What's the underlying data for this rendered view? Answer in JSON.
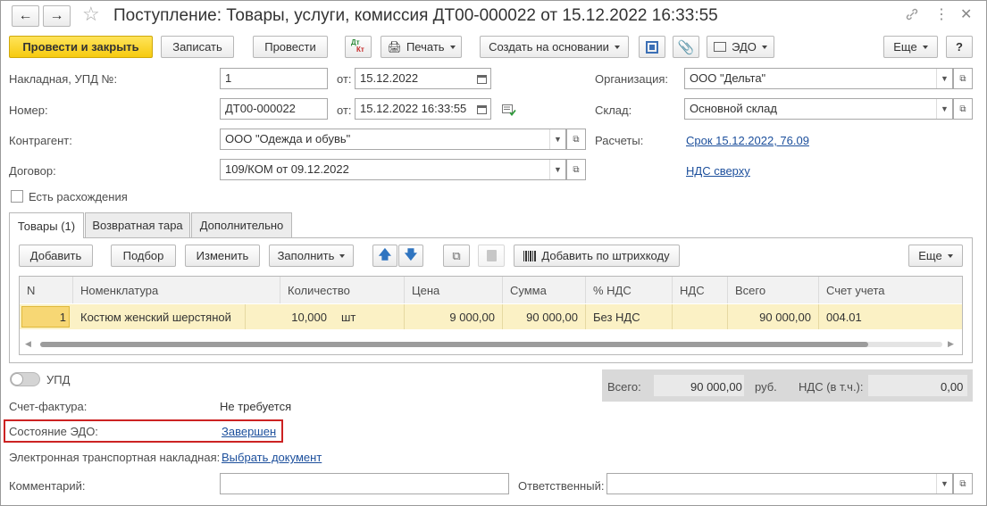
{
  "window": {
    "title": "Поступление: Товары, услуги, комиссия ДТ00-000022 от 15.12.2022 16:33:55"
  },
  "toolbar": {
    "post_close": "Провести и закрыть",
    "save": "Записать",
    "post": "Провести",
    "dtkt_top": "Дт",
    "dtkt_bottom": "Кт",
    "print": "Печать",
    "create_based": "Создать на основании",
    "edo": "ЭДО",
    "more": "Еще",
    "help": "?"
  },
  "form": {
    "invoice_label": "Накладная, УПД №:",
    "invoice_number": "1",
    "from_label": "от:",
    "invoice_date": "15.12.2022",
    "number_label": "Номер:",
    "number": "ДТ00-000022",
    "number_date": "15.12.2022 16:33:55",
    "counterparty_label": "Контрагент:",
    "counterparty": "ООО \"Одежда и обувь\"",
    "contract_label": "Договор:",
    "contract": "109/КОМ от 09.12.2022",
    "organization_label": "Организация:",
    "organization": "ООО \"Дельта\"",
    "warehouse_label": "Склад:",
    "warehouse": "Основной склад",
    "settlements_label": "Расчеты:",
    "settlements_link": "Срок 15.12.2022, 76.09",
    "vat_link": "НДС сверху",
    "discrepancy_label": "Есть расхождения"
  },
  "tabs": [
    "Товары (1)",
    "Возвратная тара",
    "Дополнительно"
  ],
  "table_toolbar": {
    "add": "Добавить",
    "select": "Подбор",
    "change": "Изменить",
    "fill": "Заполнить",
    "barcode": "Добавить по штрихкоду",
    "more": "Еще"
  },
  "table": {
    "columns": [
      "N",
      "Номенклатура",
      "Количество",
      "Цена",
      "Сумма",
      "% НДС",
      "НДС",
      "Всего",
      "Счет учета"
    ],
    "rows": [
      {
        "n": "1",
        "item": "Костюм женский шерстяной",
        "qty": "10,000",
        "unit": "шт",
        "price": "9 000,00",
        "sum": "90 000,00",
        "vat_rate": "Без НДС",
        "vat": "",
        "total": "90 000,00",
        "account": "004.01"
      }
    ]
  },
  "footer": {
    "upd_label": "УПД",
    "total_label": "Всего:",
    "total_value": "90 000,00",
    "currency": "руб.",
    "vat_incl_label": "НДС (в т.ч.):",
    "vat_value": "0,00",
    "invoice_label": "Счет-фактура:",
    "invoice_value": "Не требуется",
    "edo_state_label": "Состояние ЭДО:",
    "edo_state_value": "Завершен",
    "ettn_label": "Электронная транспортная накладная:",
    "ettn_link": "Выбрать документ",
    "comment_label": "Комментарий:",
    "comment_value": "",
    "responsible_label": "Ответственный:",
    "responsible_value": ""
  },
  "colors": {
    "primary": "#f6ca0f",
    "row_highlight": "#fbf1c5",
    "link": "#1c4f9c",
    "highlight_box": "#cc2222"
  }
}
